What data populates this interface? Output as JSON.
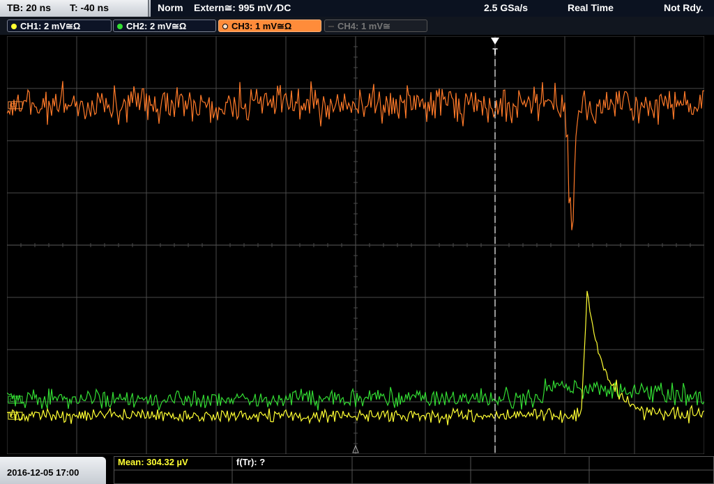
{
  "header": {
    "timebase": "TB: 20 ns",
    "trigger_offset": "T: -40 ns",
    "mode": "Norm",
    "trigger_source": "Extern≅: 995 mV ∕DC",
    "sample_rate": "2.5 GSa/s",
    "acq_mode": "Real Time",
    "status": "Not Rdy."
  },
  "channels": [
    {
      "label": "CH1: 2 mV≅Ω",
      "color": "#ffff33",
      "active": true
    },
    {
      "label": "CH2: 2 mV≅Ω",
      "color": "#33dd33",
      "active": true
    },
    {
      "label": "CH3: 1 mV≅Ω",
      "color": "#ff8c3a",
      "active": true
    },
    {
      "label": "CH4: 1 mV≅",
      "color": "#777777",
      "active": false
    }
  ],
  "trigger_marker": "T",
  "markers": {
    "ch3": "C3",
    "ch2": "C2",
    "ch1": "C1"
  },
  "footer": {
    "datetime": "2016-12-05 17:00",
    "measurement": "Mean: 304.32 µV",
    "measurement2": "f(Tr): ?"
  },
  "colors": {
    "ch1": "#ffff33",
    "ch2": "#33dd33",
    "ch3": "#ff7a29",
    "grid": "#4a4a4a"
  }
}
